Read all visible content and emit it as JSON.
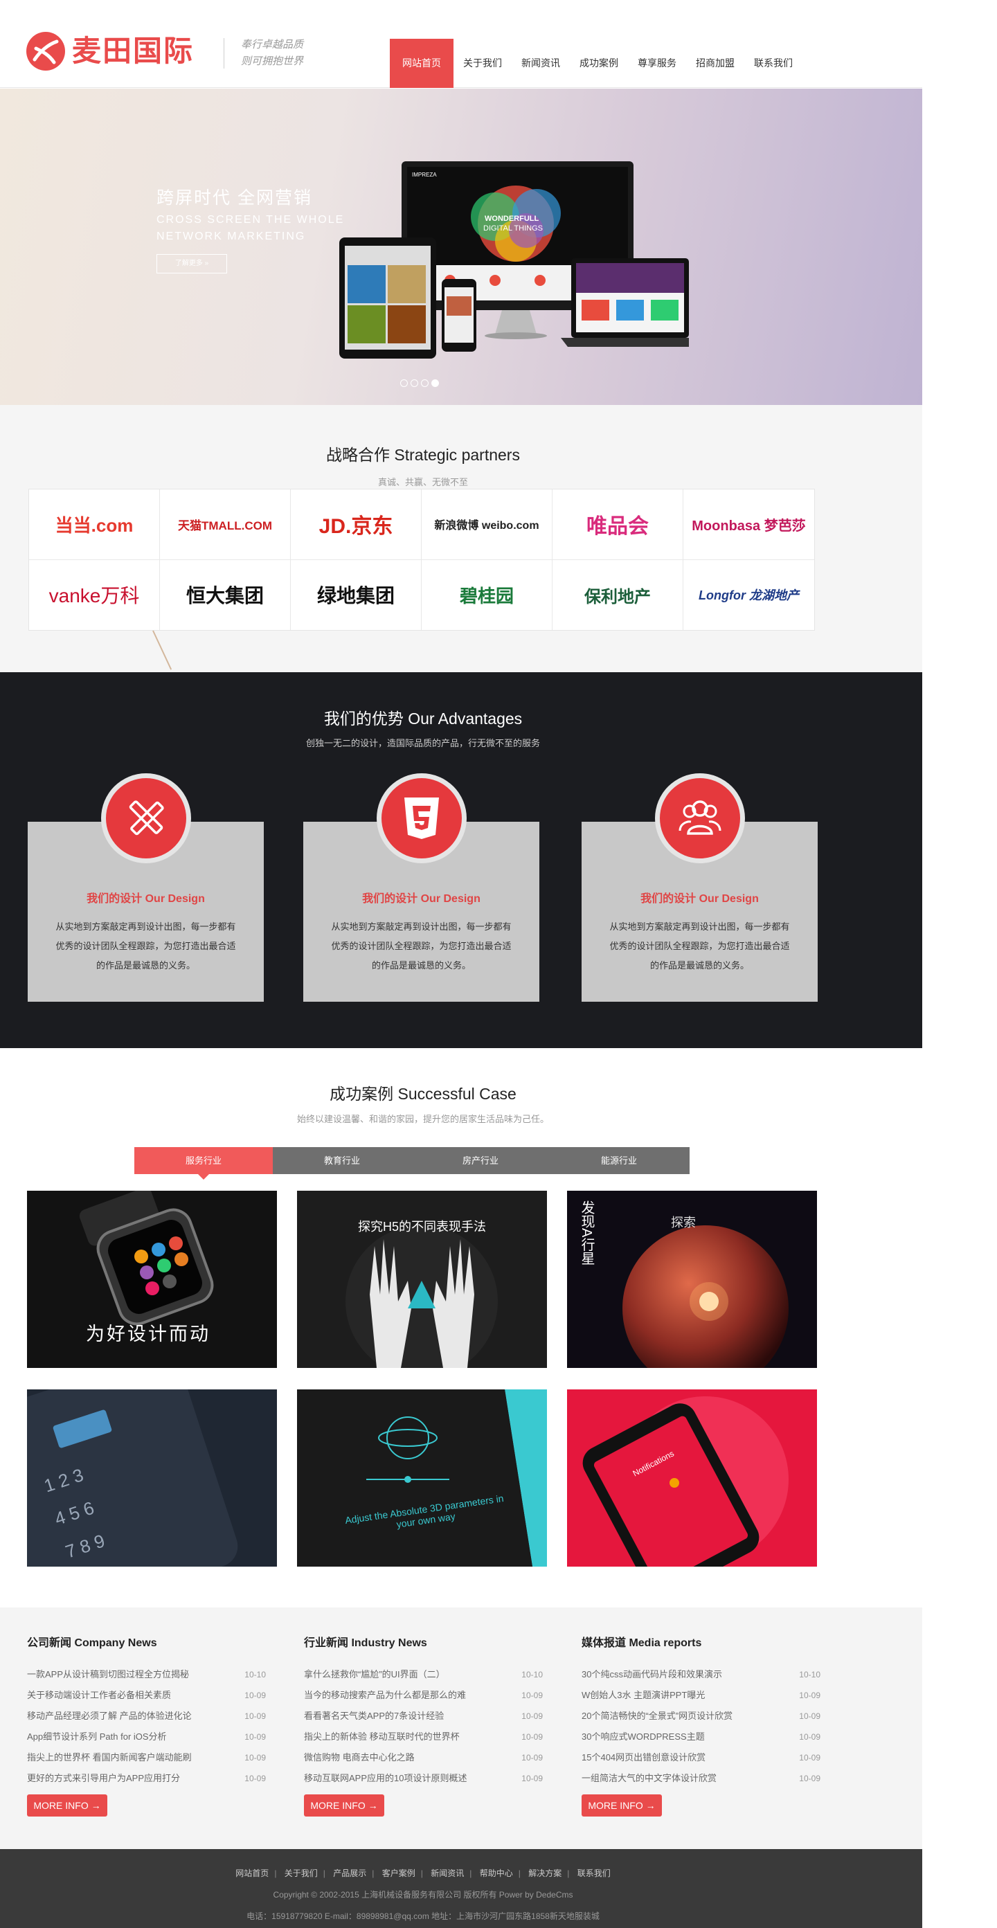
{
  "header": {
    "logo_text": "麦田国际",
    "slogan_line1": "奉行卓越品质",
    "slogan_line2": "则可拥抱世界",
    "nav": [
      {
        "label": "网站首页",
        "active": true
      },
      {
        "label": "关于我们"
      },
      {
        "label": "新闻资讯"
      },
      {
        "label": "成功案例"
      },
      {
        "label": "尊享服务"
      },
      {
        "label": "招商加盟"
      },
      {
        "label": "联系我们"
      }
    ]
  },
  "banner": {
    "title": "跨屏时代  全网营销",
    "subtitle": "CROSS SCREEN THE WHOLE NETWORK MARKETING",
    "button": "了解更多 »",
    "screen_brand": "IMPREZA",
    "screen_text_line1": "WONDERFULL",
    "screen_text_line2": "DIGITAL THINGS",
    "dots": 4,
    "active_dot": 4
  },
  "partners": {
    "title": "战略合作 Strategic partners",
    "subtitle": "真诚、共赢、无微不至",
    "logos": [
      {
        "name": "当当",
        "text": "当当.com",
        "color": "#e63a2f"
      },
      {
        "name": "天猫",
        "text": "天猫TMALL.COM",
        "color": "#cc1f22"
      },
      {
        "name": "京东",
        "text": "JD.京东",
        "color": "#d9261c"
      },
      {
        "name": "新浪微博",
        "text": "新浪微博 weibo.com",
        "color": "#222222"
      },
      {
        "name": "唯品会",
        "text": "唯品会",
        "color": "#d92b7c"
      },
      {
        "name": "梦芭莎",
        "text": "Moonbasa 梦芭莎",
        "color": "#c2185b"
      },
      {
        "name": "万科",
        "text": "vanke万科",
        "color": "#c8102e"
      },
      {
        "name": "恒大集团",
        "text": "恒大集团",
        "color": "#111111"
      },
      {
        "name": "绿地集团",
        "text": "绿地集团",
        "color": "#111111"
      },
      {
        "name": "碧桂园",
        "text": "碧桂园",
        "color": "#e0a800"
      },
      {
        "name": "保利地产",
        "text": "保利地产",
        "color": "#1b5e3a"
      },
      {
        "name": "龙湖地产",
        "text": "Longfor 龙湖地产",
        "color": "#1f3c88"
      }
    ]
  },
  "advantages": {
    "title": "我们的优势 Our Advantages",
    "subtitle": "创独一无二的设计，造国际品质的产品，行无微不至的服务",
    "cards": [
      {
        "icon": "ruler-pencil-icon",
        "title": "我们的设计 Our Design",
        "text": "从实地到方案敲定再到设计出图，每一步都有优秀的设计团队全程跟踪，为您打造出最合适的作品是最诚恳的义务。"
      },
      {
        "icon": "html5-icon",
        "title": "我们的设计 Our Design",
        "text": "从实地到方案敲定再到设计出图，每一步都有优秀的设计团队全程跟踪，为您打造出最合适的作品是最诚恳的义务。"
      },
      {
        "icon": "users-icon",
        "title": "我们的设计 Our Design",
        "text": "从实地到方案敲定再到设计出图，每一步都有优秀的设计团队全程跟踪，为您打造出最合适的作品是最诚恳的义务。"
      }
    ]
  },
  "cases": {
    "title": "成功案例 Successful Case",
    "subtitle": "始终以建设温馨、和谐的家园，提升您的居家生活品味为己任。",
    "tabs": [
      {
        "label": "服务行业",
        "active": true
      },
      {
        "label": "教育行业"
      },
      {
        "label": "房产行业"
      },
      {
        "label": "能源行业"
      }
    ],
    "items": [
      {
        "name": "smartwatch",
        "caption": "为好设计而动"
      },
      {
        "name": "h5-hands",
        "caption": "探究H5的不同表现手法"
      },
      {
        "name": "planet",
        "caption": "发现A行星",
        "caption2": "探索"
      },
      {
        "name": "phone-keypad",
        "caption": ""
      },
      {
        "name": "3d-app",
        "caption": "Adjust the Absolute 3D parameters in your own way"
      },
      {
        "name": "phone-red",
        "caption": "Notifications"
      }
    ]
  },
  "news": {
    "columns": [
      {
        "heading": "公司新闻 Company News",
        "items": [
          {
            "title": "一款APP从设计稿到切图过程全方位揭秘",
            "date": "10-10"
          },
          {
            "title": "关于移动端设计工作者必备相关素质",
            "date": "10-09"
          },
          {
            "title": "移动产品经理必须了解 产品的体验进化论",
            "date": "10-09"
          },
          {
            "title": "App细节设计系列 Path for iOS分析",
            "date": "10-09"
          },
          {
            "title": "指尖上的世界杯 看国内新闻客户端动能刷",
            "date": "10-09"
          },
          {
            "title": "更好的方式来引导用户为APP应用打分",
            "date": "10-09"
          }
        ],
        "more": "MORE INFO →"
      },
      {
        "heading": "行业新闻 Industry News",
        "items": [
          {
            "title": "拿什么拯救你“尴尬”的UI界面（二）",
            "date": "10-10"
          },
          {
            "title": "当今的移动搜索产品为什么都是那么的难",
            "date": "10-09"
          },
          {
            "title": "看看著名天气类APP的7条设计经验",
            "date": "10-09"
          },
          {
            "title": "指尖上的新体验 移动互联时代的世界杯",
            "date": "10-09"
          },
          {
            "title": "微信购物 电商去中心化之路",
            "date": "10-09"
          },
          {
            "title": "移动互联网APP应用的10项设计原则概述",
            "date": "10-09"
          }
        ],
        "more": "MORE INFO →"
      },
      {
        "heading": "媒体报道 Media reports",
        "items": [
          {
            "title": "30个纯css动画代码片段和效果演示",
            "date": "10-10"
          },
          {
            "title": "W创始人3水 主题演讲PPT曝光",
            "date": "10-09"
          },
          {
            "title": "20个简洁畅快的“全景式”网页设计欣赏",
            "date": "10-09"
          },
          {
            "title": "30个响应式WORDPRESS主题",
            "date": "10-09"
          },
          {
            "title": "15个404网页出错创意设计欣赏",
            "date": "10-09"
          },
          {
            "title": "一组简洁大气的中文字体设计欣赏",
            "date": "10-09"
          }
        ],
        "more": "MORE INFO →"
      }
    ]
  },
  "footer": {
    "links": [
      "网站首页",
      "关于我们",
      "产品展示",
      "客户案例",
      "新闻资讯",
      "帮助中心",
      "解决方案",
      "联系我们"
    ],
    "copyright": "Copyright © 2002-2015 上海机械设备服务有限公司 版权所有 Power by DedeCms",
    "contact": "电话：15918779820 E-mail：89898981@qq.com 地址：上海市沙河广园东路1858新天地服装城"
  },
  "colors": {
    "brand": "#e94b4b",
    "dark_section": "#1b1c20",
    "tab_bar": "#6f6f6f",
    "footer": "#3a3a3a"
  }
}
